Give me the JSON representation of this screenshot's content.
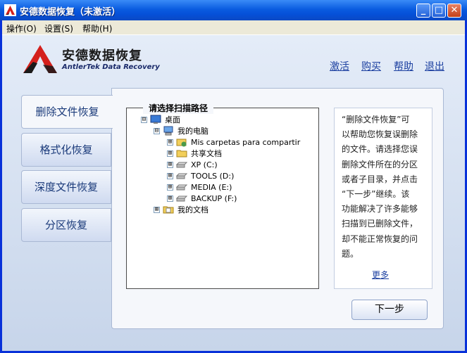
{
  "window": {
    "title": "安德数据恢复（未激活）",
    "minimize": "_",
    "maximize": "□",
    "close": "✕"
  },
  "menu": [
    "操作(O)",
    "设置(S)",
    "帮助(H)"
  ],
  "brand": {
    "name_cn": "安德数据恢复",
    "name_en": "AntlerTek Data Recovery"
  },
  "top_links": [
    "激活",
    "购买",
    "帮助",
    "退出"
  ],
  "side_tabs": [
    {
      "label": "删除文件恢复",
      "active": true
    },
    {
      "label": "格式化恢复",
      "active": false
    },
    {
      "label": "深度文件恢复",
      "active": false
    },
    {
      "label": "分区恢复",
      "active": false
    }
  ],
  "tree": {
    "title": "请选择扫描路径",
    "nodes": [
      {
        "label": "桌面",
        "icon": "desktop-icon",
        "expander": "⊟"
      },
      {
        "label": "我的电脑",
        "icon": "computer-icon",
        "expander": "⊟"
      },
      {
        "label": "Mis carpetas para compartir",
        "icon": "shared-folder-icon",
        "expander": "⊞"
      },
      {
        "label": "共享文档",
        "icon": "folder-icon",
        "expander": "⊞"
      },
      {
        "label": "XP (C:)",
        "icon": "drive-icon",
        "expander": "⊞"
      },
      {
        "label": "TOOLS (D:)",
        "icon": "drive-icon",
        "expander": "⊞"
      },
      {
        "label": "MEDIA (E:)",
        "icon": "drive-icon",
        "expander": "⊞"
      },
      {
        "label": "BACKUP (F:)",
        "icon": "drive-icon",
        "expander": "⊞"
      },
      {
        "label": "我的文档",
        "icon": "documents-icon",
        "expander": "⊞"
      }
    ]
  },
  "description": {
    "lines": [
      "“删除文件恢复”可",
      "以帮助您恢复误删除",
      "的文件。请选择您误",
      "删除文件所在的分区",
      "或者子目录，并点击",
      "“下一步”继续。该",
      "功能解决了许多能够",
      "扫描到已删除文件，",
      "却不能正常恢复的问",
      "题。"
    ],
    "more": "更多"
  },
  "next_button": "下一步"
}
